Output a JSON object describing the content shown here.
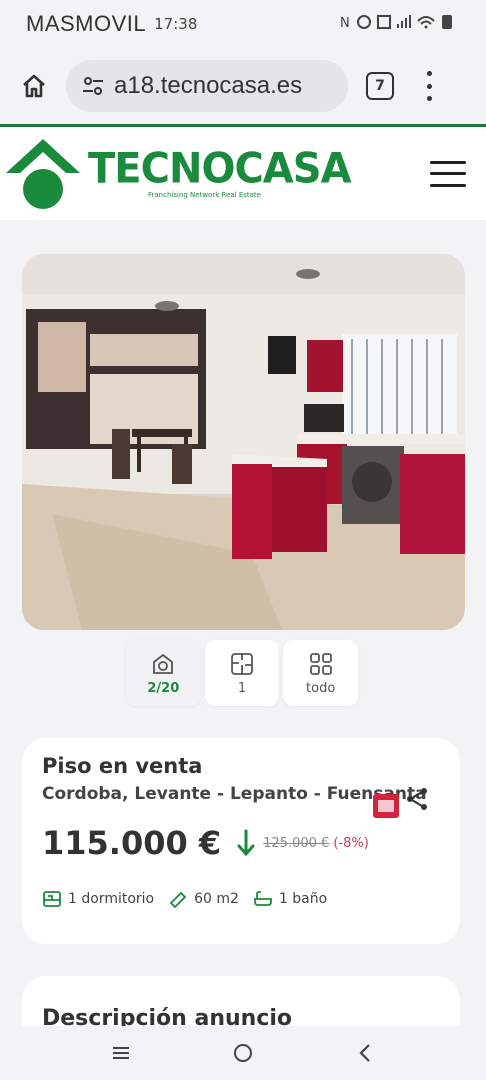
{
  "status_bar": {
    "carrier": "MASMOVIL",
    "time": "17:38",
    "icons": [
      "nfc-icon",
      "settings-icon",
      "vibrate-icon",
      "signal-icon",
      "wifi-icon",
      "battery-icon"
    ]
  },
  "browser": {
    "url": "a18.tecnocasa.es",
    "tab_count": "7",
    "icons": [
      "home-icon",
      "site-settings-icon",
      "tabs-icon",
      "more-vert-icon"
    ]
  },
  "header": {
    "brand": "TECNOCASA",
    "tagline": "Franchising Network Real Estate",
    "brand_color": "#1a8a3c"
  },
  "gallery": {
    "buttons": [
      {
        "label": "2/20",
        "icon": "photo-camera-icon",
        "active": true
      },
      {
        "label": "1",
        "icon": "floor-plan-icon",
        "active": false
      },
      {
        "label": "todo",
        "icon": "grid-icon",
        "active": false
      }
    ]
  },
  "listing": {
    "type": "Piso en venta",
    "location": "Cordoba, Levante - Lepanto - Fuensanta",
    "price": "115.000 €",
    "old_price": "125.000 €",
    "discount": "(-8%)",
    "features": [
      {
        "icon": "bed-icon",
        "text": "1 dormitorio"
      },
      {
        "icon": "ruler-icon",
        "text": "60 m2"
      },
      {
        "icon": "bath-icon",
        "text": "1 baño"
      }
    ],
    "accent_price_drop": "#1a8a3c",
    "discount_color": "#c23b5a"
  },
  "description": {
    "title": "Descripción anuncio"
  },
  "nav": {
    "icons": [
      "recent-apps-icon",
      "home-circle-icon",
      "back-icon"
    ]
  }
}
